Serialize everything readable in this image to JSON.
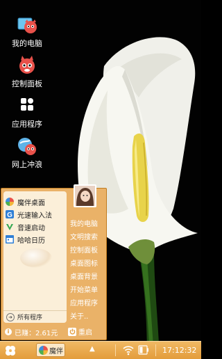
{
  "desktop": {
    "icons": [
      {
        "label": "我的电脑",
        "icon": "my-computer-icon"
      },
      {
        "label": "控制面板",
        "icon": "control-panel-icon"
      },
      {
        "label": "应用程序",
        "icon": "applications-icon"
      },
      {
        "label": "网上冲浪",
        "icon": "internet-icon"
      }
    ]
  },
  "start_menu": {
    "apps": [
      {
        "label": "魔伴桌面",
        "icon": "pinwheel-icon"
      },
      {
        "label": "光速输入法",
        "icon": "keyboard-g-icon"
      },
      {
        "label": "音速启动",
        "icon": "v-launch-icon"
      },
      {
        "label": "哈哈日历",
        "icon": "calendar-icon"
      }
    ],
    "all_programs": "所有程序",
    "right_items": [
      "我的电脑",
      "文明搜索",
      "控制面板",
      "桌面图标",
      "桌面背景",
      "开始菜单",
      "应用程序",
      "关于.."
    ],
    "earned": "已赚：2.61元",
    "restart": "重启"
  },
  "taskbar": {
    "task_label": "魔伴",
    "clock": "17:12:32"
  },
  "colors": {
    "accent": "#e8a24a",
    "menu_panel": "#fbefd9"
  }
}
